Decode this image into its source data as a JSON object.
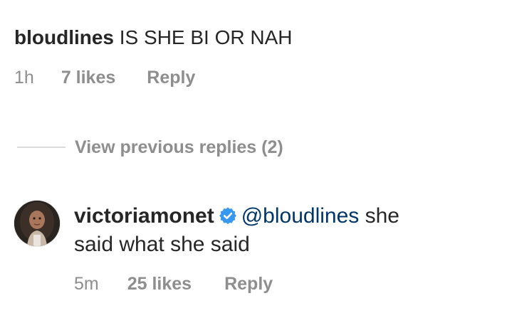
{
  "comment": {
    "username": "bloudlines",
    "text": "IS SHE BI OR NAH",
    "time": "1h",
    "likes": "7 likes",
    "reply_label": "Reply"
  },
  "view_replies": {
    "label": "View previous replies (2)"
  },
  "reply": {
    "username": "victoriamonet",
    "verified_icon": "verified-badge-icon",
    "mention": "@bloudlines",
    "text_after_mention": " she",
    "text_line2": "said what she said",
    "time": "5m",
    "likes": "25 likes",
    "reply_label": "Reply"
  },
  "colors": {
    "text": "#262626",
    "secondary": "#8e8e8e",
    "mention": "#003569",
    "verified": "#3897f0",
    "divider": "#dbdbdb"
  }
}
